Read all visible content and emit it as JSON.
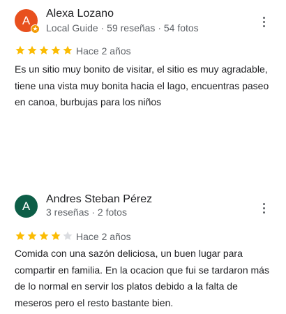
{
  "reviews": [
    {
      "initial": "A",
      "avatar_color": "#e8501e",
      "badge_icon": "local-guide-star-icon",
      "name": "Alexa Lozano",
      "meta": "Local Guide · 59 reseñas · 54 fotos",
      "rating": 5,
      "date": "Hace 2 años",
      "text": "Es un sitio muy bonito de visitar, el sitio es muy agradable, tiene una vista muy bonita hacia el lago, encuentras paseo en canoa, burbujas para los niños"
    },
    {
      "initial": "A",
      "avatar_color": "#0d5e47",
      "name": "Andres Steban Pérez",
      "meta": "3 reseñas · 2 fotos",
      "rating": 4,
      "date": "Hace 2 años",
      "text": "Comida con una sazón deliciosa, un buen lugar para compartir en familia. En la ocacion que fui se tardaron más de lo normal en servir los platos debido a la falta de meseros pero el resto bastante bien."
    }
  ],
  "colors": {
    "star_filled": "#fbbc04",
    "star_empty": "#dadce0"
  },
  "icons": {
    "star": "star-icon",
    "more": "more-vert-icon"
  }
}
